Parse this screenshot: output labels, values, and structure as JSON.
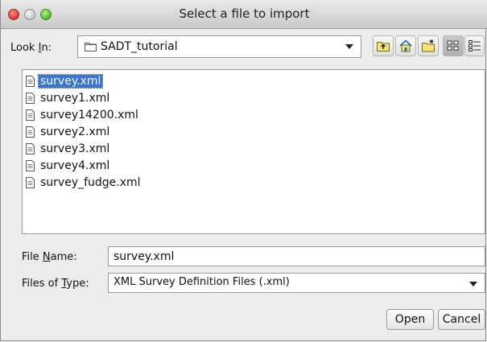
{
  "window": {
    "title": "Select a file to import"
  },
  "look_in": {
    "label_prefix": "Look ",
    "label_mnemonic": "I",
    "label_suffix": "n:",
    "value": "SADT_tutorial",
    "icon": "folder-icon"
  },
  "toolbar": {
    "buttons": [
      {
        "name": "up-one-level",
        "icon": "folder-up-icon"
      },
      {
        "name": "home",
        "icon": "home-icon"
      },
      {
        "name": "new-folder",
        "icon": "new-folder-icon"
      },
      {
        "name": "list-view",
        "icon": "list-view-icon",
        "active": true
      },
      {
        "name": "details-view",
        "icon": "details-view-icon",
        "active": false
      }
    ]
  },
  "files": [
    {
      "name": "survey.xml",
      "selected": true
    },
    {
      "name": "survey1.xml",
      "selected": false
    },
    {
      "name": "survey14200.xml",
      "selected": false
    },
    {
      "name": "survey2.xml",
      "selected": false
    },
    {
      "name": "survey3.xml",
      "selected": false
    },
    {
      "name": "survey4.xml",
      "selected": false
    },
    {
      "name": "survey_fudge.xml",
      "selected": false
    }
  ],
  "file_name": {
    "label_prefix": "File ",
    "label_mnemonic": "N",
    "label_suffix": "ame:",
    "value": "survey.xml"
  },
  "file_type": {
    "label_prefix": "Files of ",
    "label_mnemonic": "T",
    "label_suffix": "ype:",
    "value": "XML Survey Definition Files (.xml)"
  },
  "buttons": {
    "open": "Open",
    "cancel": "Cancel"
  },
  "colors": {
    "selection": "#3875d7",
    "window_bg": "#ececec"
  }
}
